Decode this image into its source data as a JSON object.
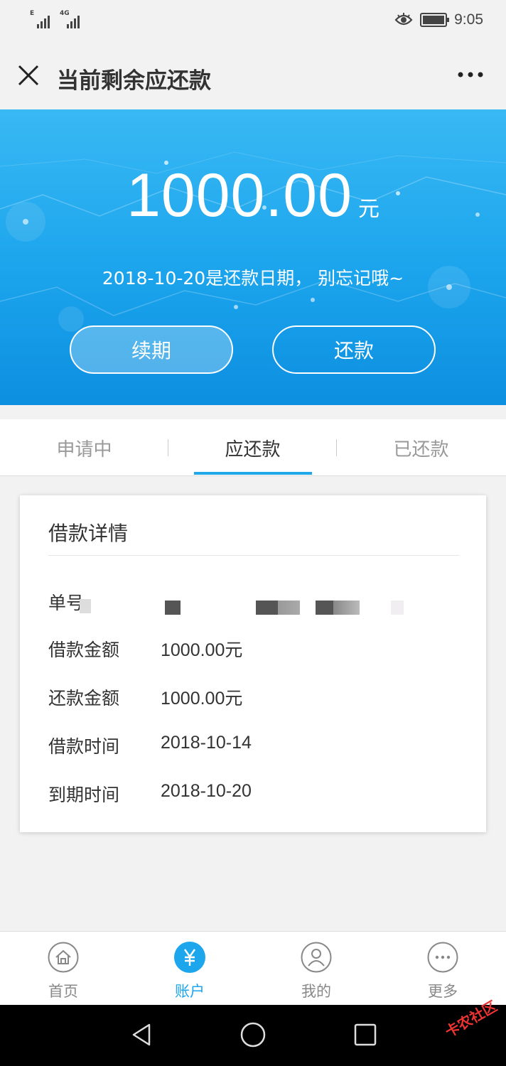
{
  "status_bar": {
    "signal1_tag": "E",
    "signal2_tag": "4G",
    "time": "9:05"
  },
  "header": {
    "title": "当前剩余应还款"
  },
  "banner": {
    "amount": "1000.00",
    "unit": "元",
    "due_notice": "2018-10-20是还款日期， 别忘记哦~",
    "renew_label": "续期",
    "repay_label": "还款"
  },
  "tabs": [
    {
      "label": "申请中",
      "active": false
    },
    {
      "label": "应还款",
      "active": true
    },
    {
      "label": "已还款",
      "active": false
    }
  ],
  "loan_card": {
    "title": "借款详情",
    "rows": [
      {
        "label": "单号",
        "value": ""
      },
      {
        "label": "借款金额",
        "value": "1000.00元"
      },
      {
        "label": "还款金额",
        "value": "1000.00元"
      },
      {
        "label": "借款时间",
        "value": "2018-10-14"
      },
      {
        "label": "到期时间",
        "value": "2018-10-20"
      }
    ]
  },
  "bottom_nav": [
    {
      "label": "首页",
      "icon": "home-icon",
      "active": false
    },
    {
      "label": "账户",
      "icon": "yuan-icon",
      "active": true
    },
    {
      "label": "我的",
      "icon": "user-icon",
      "active": false
    },
    {
      "label": "更多",
      "icon": "more-dots-icon",
      "active": false
    }
  ],
  "watermark": "卡农社区",
  "colors": {
    "accent": "#1ea6ec",
    "banner_top": "#39b9f4",
    "banner_bottom": "#0d8fe0"
  }
}
